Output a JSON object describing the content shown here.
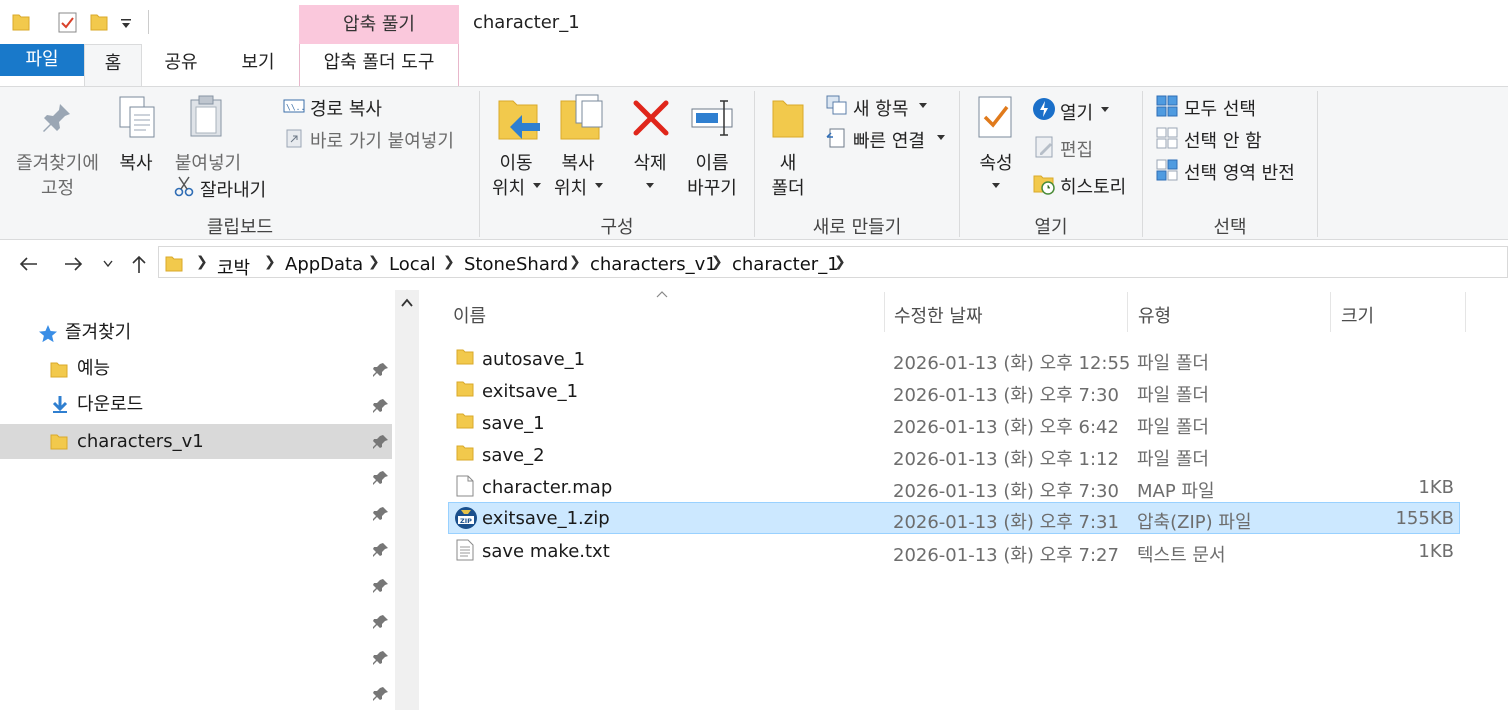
{
  "window": {
    "title": "character_1",
    "context_tab": "압축 풀기"
  },
  "quick_access_toolbar": {
    "icons": [
      "folder-icon",
      "properties-check-icon",
      "new-folder-icon",
      "customize-dropdown-icon"
    ]
  },
  "tabs": {
    "file": "파일",
    "home": "홈",
    "share": "공유",
    "view": "보기",
    "compressed_tools": "압축 폴더 도구"
  },
  "ribbon": {
    "clipboard": {
      "label": "클립보드",
      "pin_line1": "즐겨찾기에",
      "pin_line2": "고정",
      "copy": "복사",
      "paste": "붙여넣기",
      "copy_path": "경로 복사",
      "paste_shortcut": "바로 가기 붙여넣기",
      "cut": "잘라내기"
    },
    "organize": {
      "label": "구성",
      "move_line1": "이동",
      "move_line2": "위치",
      "copy_line1": "복사",
      "copy_line2": "위치",
      "delete": "삭제",
      "rename_line1": "이름",
      "rename_line2": "바꾸기"
    },
    "new": {
      "label": "새로 만들기",
      "new_folder_line1": "새",
      "new_folder_line2": "폴더",
      "new_item": "새 항목",
      "easy_access": "빠른 연결"
    },
    "open": {
      "label": "열기",
      "properties": "속성",
      "open": "열기",
      "edit": "편집",
      "history": "히스토리"
    },
    "select": {
      "label": "선택",
      "select_all": "모두 선택",
      "select_none": "선택 안 함",
      "invert": "선택 영역 반전"
    }
  },
  "address_bar": {
    "crumbs": [
      "코박",
      "AppData",
      "Local",
      "StoneShard",
      "characters_v1",
      "character_1"
    ]
  },
  "navigation": {
    "quick_access": "즐겨찾기",
    "items": [
      {
        "label": "예능",
        "icon": "folder-icon"
      },
      {
        "label": "다운로드",
        "icon": "download-arrow-icon"
      },
      {
        "label": "characters_v1",
        "icon": "folder-icon"
      }
    ]
  },
  "file_list": {
    "columns": {
      "name": "이름",
      "modified": "수정한 날짜",
      "type": "유형",
      "size": "크기"
    },
    "rows": [
      {
        "name": "autosave_1",
        "modified": "2026-01-13 (화) 오후 12:55",
        "type": "파일 폴더",
        "size": "",
        "icon": "folder-icon"
      },
      {
        "name": "exitsave_1",
        "modified": "2026-01-13 (화) 오후 7:30",
        "type": "파일 폴더",
        "size": "",
        "icon": "folder-icon"
      },
      {
        "name": "save_1",
        "modified": "2026-01-13 (화) 오후 6:42",
        "type": "파일 폴더",
        "size": "",
        "icon": "folder-icon"
      },
      {
        "name": "save_2",
        "modified": "2026-01-13 (화) 오후 1:12",
        "type": "파일 폴더",
        "size": "",
        "icon": "folder-icon"
      },
      {
        "name": "character.map",
        "modified": "2026-01-13 (화) 오후 7:30",
        "type": "MAP 파일",
        "size": "1KB",
        "icon": "file-icon"
      },
      {
        "name": "exitsave_1.zip",
        "modified": "2026-01-13 (화) 오후 7:31",
        "type": "압축(ZIP) 파일",
        "size": "155KB",
        "icon": "zip-icon"
      },
      {
        "name": "save make.txt",
        "modified": "2026-01-13 (화) 오후 7:27",
        "type": "텍스트 문서",
        "size": "1KB",
        "icon": "text-file-icon"
      }
    ],
    "selected_index": 5
  },
  "colors": {
    "selection": "#cce8ff",
    "selection_border": "#99d1ff",
    "file_tab": "#1979ca",
    "context_tab": "#fac8dc",
    "folder": "#f2c94c"
  }
}
